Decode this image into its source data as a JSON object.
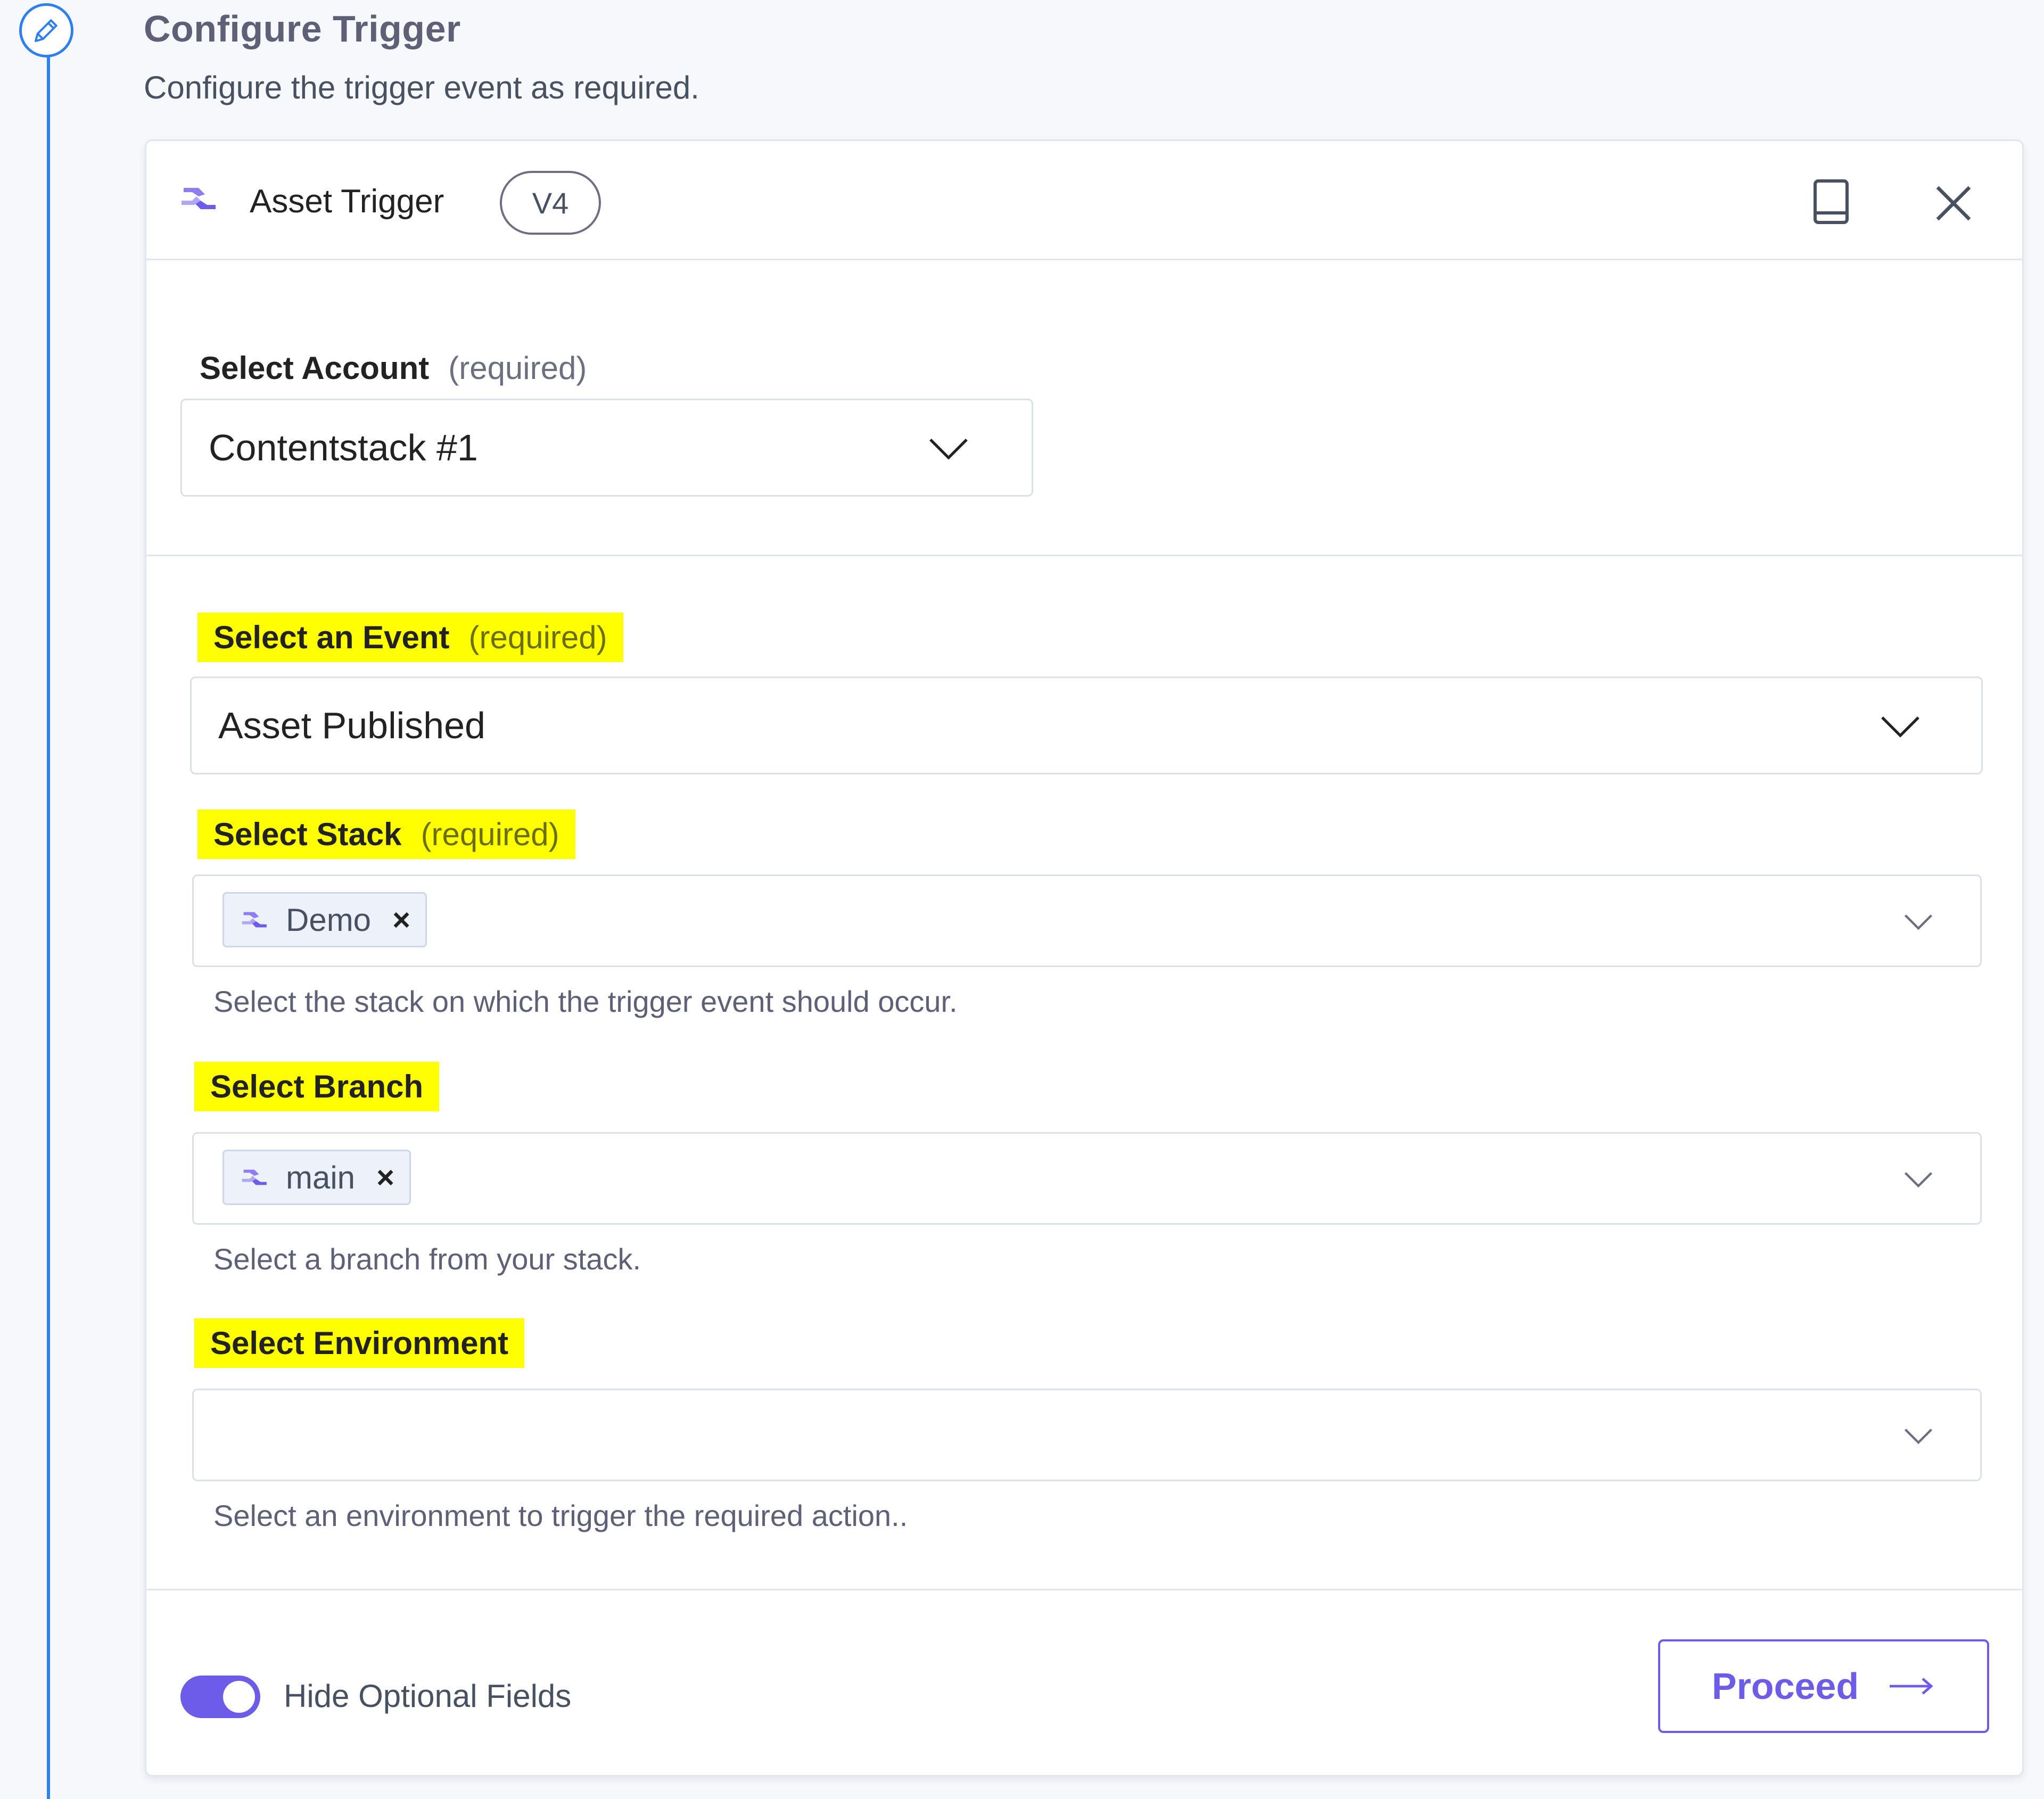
{
  "step": {
    "title": "Configure Trigger",
    "subtitle": "Configure the trigger event as required.",
    "icon": "pencil-icon"
  },
  "header": {
    "title": "Asset Trigger",
    "version": "V4",
    "logo_icon": "contentstack-logo-icon",
    "doc_icon": "book-icon",
    "close_icon": "close-icon"
  },
  "account": {
    "label": "Select Account",
    "required": "(required)",
    "value": "Contentstack #1"
  },
  "event": {
    "label": "Select an Event",
    "required": "(required)",
    "value": "Asset Published"
  },
  "stack": {
    "label": "Select Stack",
    "required": "(required)",
    "chip": "Demo",
    "helper": "Select the stack on which the trigger event should occur."
  },
  "branch": {
    "label": "Select Branch",
    "chip": "main",
    "helper": "Select a branch from your stack."
  },
  "environment": {
    "label": "Select Environment",
    "value": "",
    "helper": "Select an environment to trigger the required action.."
  },
  "footer": {
    "toggle_label": "Hide Optional Fields",
    "toggle_on": true,
    "proceed_label": "Proceed"
  },
  "colors": {
    "accent": "#6c5ce7",
    "timeline": "#2f80ed",
    "highlight": "#ffff00"
  }
}
